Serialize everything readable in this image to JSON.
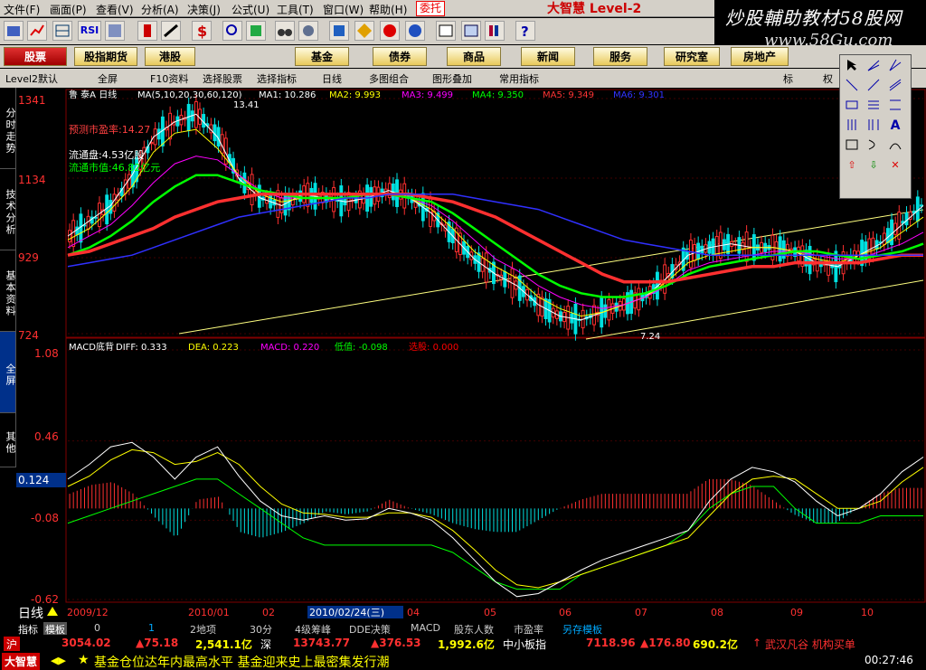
{
  "menu": {
    "items": [
      "文件(F)",
      "画面(P)",
      "查看(V)",
      "分析(A)",
      "决策(J)",
      "公式(U)",
      "工具(T)",
      "窗口(W)",
      "帮助(H)"
    ],
    "hot": "委托",
    "logo": "大智慧 Level-2"
  },
  "ad": {
    "line1": "炒股輔助教材58股网",
    "line2": "www.58Gu.com"
  },
  "toolbar": {
    "rsi_label": "RSI"
  },
  "tabs": [
    "股票",
    "股指期货",
    "港股",
    "基金",
    "债券",
    "商品",
    "新闻",
    "服务",
    "研究室",
    "房地产"
  ],
  "subbar": {
    "items": [
      "Level2默认",
      "全屏",
      "F10资料",
      "选择股票",
      "选择指标",
      "日线",
      "多图组合",
      "图形叠加",
      "常用指标"
    ],
    "right": [
      "标",
      "权"
    ]
  },
  "sidetabs": [
    "分时走势",
    "技术分析",
    "基本资料",
    "全屏",
    "其他"
  ],
  "chart_data": [
    {
      "type": "candlestick",
      "title": "鲁 泰A 日线",
      "ma_label": "MA(5,10,20,30,60,120)",
      "legend": [
        {
          "name": "MA1",
          "value": "10.286",
          "color": "#ffffff"
        },
        {
          "name": "MA2",
          "value": "9.993",
          "color": "#ffff00"
        },
        {
          "name": "MA3",
          "value": "9.499",
          "color": "#ff00ff"
        },
        {
          "name": "MA4",
          "value": "9.350",
          "color": "#00ff00"
        },
        {
          "name": "MA5",
          "value": "9.349",
          "color": "#ff3030"
        },
        {
          "name": "MA6",
          "value": "9.301",
          "color": "#3030ff"
        }
      ],
      "y_ticks": [
        "1341",
        "1134",
        "929",
        "724"
      ],
      "ylim": [
        7.24,
        13.41
      ],
      "annotations": [
        "13.41",
        "7.24"
      ],
      "info": [
        "预测市盈率:14.27",
        "流通盘:4.53亿股",
        "流通市值:46.82亿元"
      ],
      "ma_series": {
        "MA1": [
          9.8,
          10.2,
          10.6,
          11.4,
          12.4,
          12.8,
          13.0,
          12.4,
          11.3,
          10.8,
          10.6,
          10.9,
          10.8,
          10.7,
          10.8,
          11.0,
          10.8,
          10.4,
          9.8,
          9.2,
          8.8,
          8.5,
          8.0,
          7.7,
          7.6,
          7.8,
          8.0,
          8.2,
          8.7,
          9.3,
          9.5,
          9.6,
          9.5,
          9.5,
          9.4,
          9.1,
          9.0,
          9.3,
          9.6,
          10.1,
          10.6
        ],
        "MA2": [
          9.7,
          10.0,
          10.5,
          11.1,
          12.0,
          12.5,
          12.6,
          12.1,
          11.4,
          10.9,
          10.7,
          10.8,
          10.8,
          10.8,
          10.9,
          10.9,
          10.8,
          10.5,
          10.0,
          9.4,
          9.0,
          8.7,
          8.2,
          7.9,
          7.7,
          7.8,
          8.0,
          8.2,
          8.6,
          9.1,
          9.3,
          9.4,
          9.5,
          9.5,
          9.4,
          9.2,
          9.1,
          9.3,
          9.5,
          9.9,
          10.3
        ],
        "MA3": [
          9.5,
          9.8,
          10.1,
          10.6,
          11.2,
          11.7,
          11.9,
          11.8,
          11.4,
          11.0,
          10.8,
          10.8,
          10.8,
          10.8,
          10.9,
          10.9,
          10.8,
          10.6,
          10.2,
          9.7,
          9.2,
          8.9,
          8.5,
          8.2,
          8.0,
          7.9,
          8.0,
          8.2,
          8.5,
          8.9,
          9.1,
          9.2,
          9.3,
          9.4,
          9.4,
          9.3,
          9.2,
          9.2,
          9.4,
          9.6,
          9.9
        ],
        "MA4": [
          9.3,
          9.5,
          9.8,
          10.2,
          10.7,
          11.1,
          11.4,
          11.4,
          11.2,
          11.0,
          10.9,
          10.8,
          10.8,
          10.8,
          10.9,
          10.9,
          10.8,
          10.7,
          10.4,
          10.0,
          9.6,
          9.2,
          8.8,
          8.5,
          8.3,
          8.2,
          8.2,
          8.3,
          8.5,
          8.8,
          9.0,
          9.1,
          9.2,
          9.3,
          9.4,
          9.4,
          9.3,
          9.2,
          9.3,
          9.4,
          9.6
        ],
        "MA5": [
          9.3,
          9.4,
          9.6,
          9.8,
          10.0,
          10.3,
          10.5,
          10.7,
          10.8,
          10.9,
          10.9,
          10.9,
          10.9,
          10.9,
          10.9,
          10.9,
          10.9,
          10.8,
          10.7,
          10.5,
          10.3,
          10.0,
          9.7,
          9.4,
          9.1,
          8.8,
          8.6,
          8.6,
          8.6,
          8.7,
          8.8,
          8.9,
          9.0,
          9.0,
          9.1,
          9.1,
          9.1,
          9.1,
          9.2,
          9.3,
          9.3
        ],
        "MA6": [
          9.0,
          9.1,
          9.2,
          9.3,
          9.5,
          9.7,
          9.9,
          10.1,
          10.3,
          10.4,
          10.5,
          10.6,
          10.7,
          10.8,
          10.8,
          10.9,
          10.9,
          10.9,
          10.9,
          10.8,
          10.7,
          10.6,
          10.5,
          10.3,
          10.1,
          9.9,
          9.7,
          9.6,
          9.5,
          9.4,
          9.3,
          9.3,
          9.3,
          9.3,
          9.3,
          9.3,
          9.3,
          9.3,
          9.3,
          9.3,
          9.3
        ]
      }
    },
    {
      "type": "bar",
      "title": "MACD底背",
      "legend": [
        {
          "name": "DIFF",
          "value": "0.333",
          "color": "#ffffff"
        },
        {
          "name": "DEA",
          "value": "0.223",
          "color": "#ffff00"
        },
        {
          "name": "MACD",
          "value": "0.220",
          "color": "#ff00ff"
        },
        {
          "name": "低值",
          "value": "-0.098",
          "color": "#00ff00"
        },
        {
          "name": "选股",
          "value": "0.000",
          "color": "#ff0000"
        }
      ],
      "y_ticks": [
        "1.08",
        "0.46",
        "-0.08",
        "-0.62"
      ],
      "current_value": "0.124",
      "ylim": [
        -0.62,
        1.08
      ],
      "diff": [
        0.2,
        0.3,
        0.42,
        0.45,
        0.35,
        0.2,
        0.35,
        0.42,
        0.22,
        0.05,
        -0.05,
        -0.08,
        -0.05,
        -0.08,
        -0.07,
        0.0,
        -0.03,
        -0.08,
        -0.2,
        -0.35,
        -0.5,
        -0.6,
        -0.58,
        -0.5,
        -0.42,
        -0.35,
        -0.3,
        -0.25,
        -0.2,
        -0.15,
        0.05,
        0.2,
        0.28,
        0.25,
        0.18,
        0.05,
        -0.05,
        0.0,
        0.1,
        0.25,
        0.35
      ],
      "dea": [
        0.15,
        0.22,
        0.33,
        0.4,
        0.38,
        0.3,
        0.32,
        0.38,
        0.3,
        0.15,
        0.03,
        -0.03,
        -0.04,
        -0.06,
        -0.06,
        -0.03,
        -0.03,
        -0.06,
        -0.15,
        -0.28,
        -0.42,
        -0.52,
        -0.54,
        -0.5,
        -0.45,
        -0.4,
        -0.35,
        -0.3,
        -0.25,
        -0.2,
        -0.05,
        0.1,
        0.2,
        0.22,
        0.2,
        0.1,
        0.0,
        0.0,
        0.05,
        0.18,
        0.28
      ],
      "low_line": [
        -0.1,
        -0.05,
        0.0,
        0.05,
        0.1,
        0.15,
        0.2,
        0.2,
        0.1,
        0.0,
        -0.1,
        -0.2,
        -0.25,
        -0.25,
        -0.25,
        -0.25,
        -0.25,
        -0.25,
        -0.3,
        -0.4,
        -0.5,
        -0.55,
        -0.55,
        -0.55,
        -0.45,
        -0.4,
        -0.35,
        -0.3,
        -0.25,
        -0.15,
        0.0,
        0.1,
        0.15,
        0.15,
        0.0,
        -0.1,
        -0.1,
        -0.1,
        -0.05,
        -0.05,
        -0.05
      ]
    }
  ],
  "x_axis": [
    "2009/12",
    "2010/01",
    "02",
    "2010/02/24(三)",
    "04",
    "05",
    "06",
    "07",
    "08",
    "09",
    "10"
  ],
  "period_label": "日线",
  "indicator_bar": [
    "指标",
    "模板",
    "0",
    "1",
    "2地项",
    "30分",
    "4级筹峰",
    "DDE决策",
    "MACD",
    "股东人数",
    "市盈率",
    "另存模板"
  ],
  "quotes": {
    "sh_label": "沪",
    "sh_index": "3054.02",
    "sh_change": "▲75.18",
    "sh_amount": "2,541.1亿",
    "sz_label": "深",
    "sz_index": "13743.77",
    "sz_change": "▲376.53",
    "sz_amount": "1,992.6亿",
    "sme_label": "中小板指",
    "sme_index": "7118.96",
    "sme_change": "▲176.80",
    "sme_amount": "690.2亿",
    "news_right": "武汉凡谷 机构买单"
  },
  "status": {
    "logo": "大智慧",
    "headline": "基金仓位达年内最高水平 基金迎来史上最密集发行潮",
    "time": "00:27:46"
  }
}
